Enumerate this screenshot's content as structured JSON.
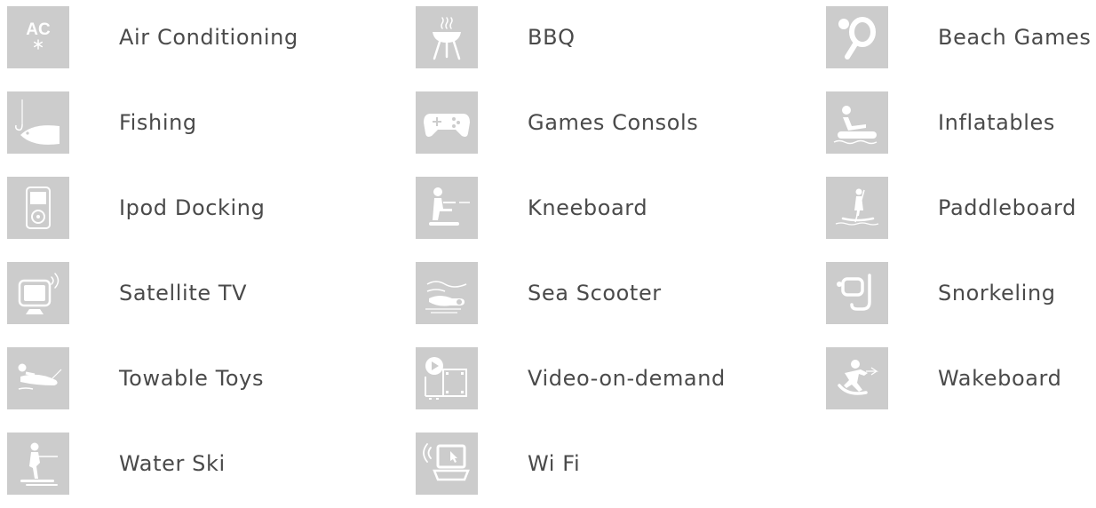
{
  "amenities": [
    {
      "label": "Air Conditioning",
      "icon": "air-conditioning-icon"
    },
    {
      "label": "BBQ",
      "icon": "bbq-icon"
    },
    {
      "label": "Beach Games",
      "icon": "beach-games-icon"
    },
    {
      "label": "Fishing",
      "icon": "fishing-icon"
    },
    {
      "label": "Games Consols",
      "icon": "game-controller-icon"
    },
    {
      "label": "Inflatables",
      "icon": "inflatables-icon"
    },
    {
      "label": "Ipod Docking",
      "icon": "ipod-icon"
    },
    {
      "label": "Kneeboard",
      "icon": "kneeboard-icon"
    },
    {
      "label": "Paddleboard",
      "icon": "paddleboard-icon"
    },
    {
      "label": "Satellite TV",
      "icon": "satellite-tv-icon"
    },
    {
      "label": "Sea Scooter",
      "icon": "sea-scooter-icon"
    },
    {
      "label": "Snorkeling",
      "icon": "snorkel-mask-icon"
    },
    {
      "label": "Towable Toys",
      "icon": "towable-toys-icon"
    },
    {
      "label": "Video-on-demand",
      "icon": "video-on-demand-icon"
    },
    {
      "label": "Wakeboard",
      "icon": "wakeboard-icon"
    },
    {
      "label": "Water Ski",
      "icon": "water-ski-icon"
    },
    {
      "label": "Wi Fi",
      "icon": "wifi-laptop-icon"
    }
  ],
  "ac_icon_text": "AC",
  "colors": {
    "tile_background": "#cccccc",
    "icon_foreground": "#ffffff",
    "label_text": "#4a4a4a"
  }
}
